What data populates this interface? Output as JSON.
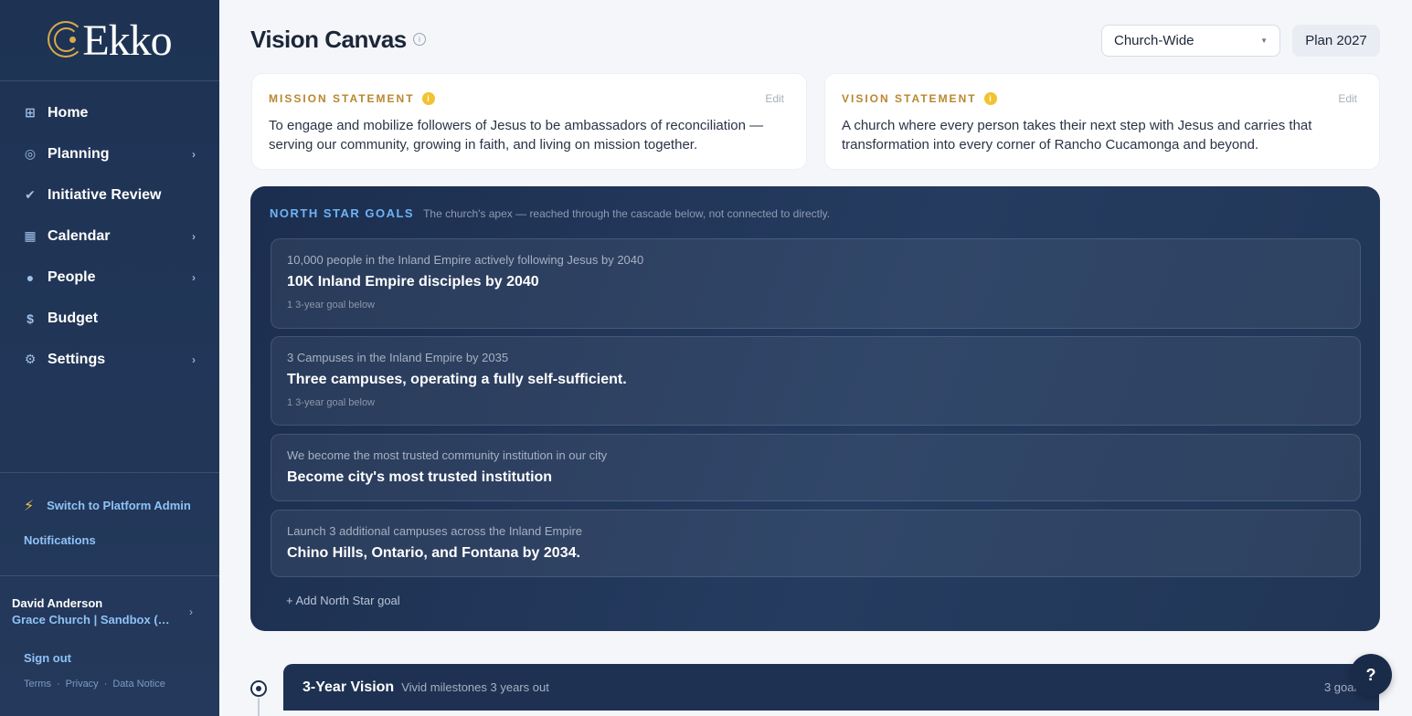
{
  "brand": {
    "name": "Ekko",
    "accent": "#d7aa4c"
  },
  "sidebar": {
    "items": [
      {
        "label": "Home",
        "icon": "grid-icon",
        "chevron": false
      },
      {
        "label": "Planning",
        "icon": "target-icon",
        "chevron": true
      },
      {
        "label": "Initiative Review",
        "icon": "check-icon",
        "chevron": false
      },
      {
        "label": "Calendar",
        "icon": "calendar-icon",
        "chevron": true
      },
      {
        "label": "People",
        "icon": "person-icon",
        "chevron": true
      },
      {
        "label": "Budget",
        "icon": "dollar-icon",
        "chevron": false
      },
      {
        "label": "Settings",
        "icon": "gear-icon",
        "chevron": true
      }
    ],
    "switch_label": "Switch to Platform Admin",
    "notifications_label": "Notifications",
    "user": {
      "name": "David Anderson",
      "org": "Grace Church | Sandbox (Si..."
    },
    "signout_label": "Sign out",
    "legal": {
      "terms": "Terms",
      "privacy": "Privacy",
      "data_notice": "Data Notice"
    }
  },
  "header": {
    "title": "Vision Canvas",
    "scope_value": "Church-Wide",
    "plan_label": "Plan 2027"
  },
  "mission": {
    "label": "MISSION STATEMENT",
    "edit_label": "Edit",
    "text": "To engage and mobilize followers of Jesus to be ambassadors of reconciliation — serving our community, growing in faith, and living on mission together."
  },
  "vision": {
    "label": "VISION STATEMENT",
    "edit_label": "Edit",
    "text": "A church where every person takes their next step with Jesus and carries that transformation into every corner of Rancho Cucamonga and beyond."
  },
  "north_star": {
    "title": "NORTH STAR GOALS",
    "subtitle": "The church's apex — reached through the cascade below, not connected to directly.",
    "goals": [
      {
        "sub": "10,000 people in the Inland Empire actively following Jesus by 2040",
        "title": "10K Inland Empire disciples by 2040",
        "meta": "1 3-year goal below"
      },
      {
        "sub": "3 Campuses in the Inland Empire by 2035",
        "title": "Three campuses, operating a fully self-sufficient.",
        "meta": "1 3-year goal below"
      },
      {
        "sub": "We become the most trusted community institution in our city",
        "title": "Become city's most trusted institution",
        "meta": ""
      },
      {
        "sub": "Launch 3 additional campuses across the Inland Empire",
        "title": "Chino Hills, Ontario, and Fontana by 2034.",
        "meta": ""
      }
    ],
    "add_label": "+ Add North Star goal"
  },
  "three_year": {
    "title": "3-Year Vision",
    "subtitle": "Vivid milestones 3 years out",
    "count": "3 goal."
  },
  "help_label": "?"
}
